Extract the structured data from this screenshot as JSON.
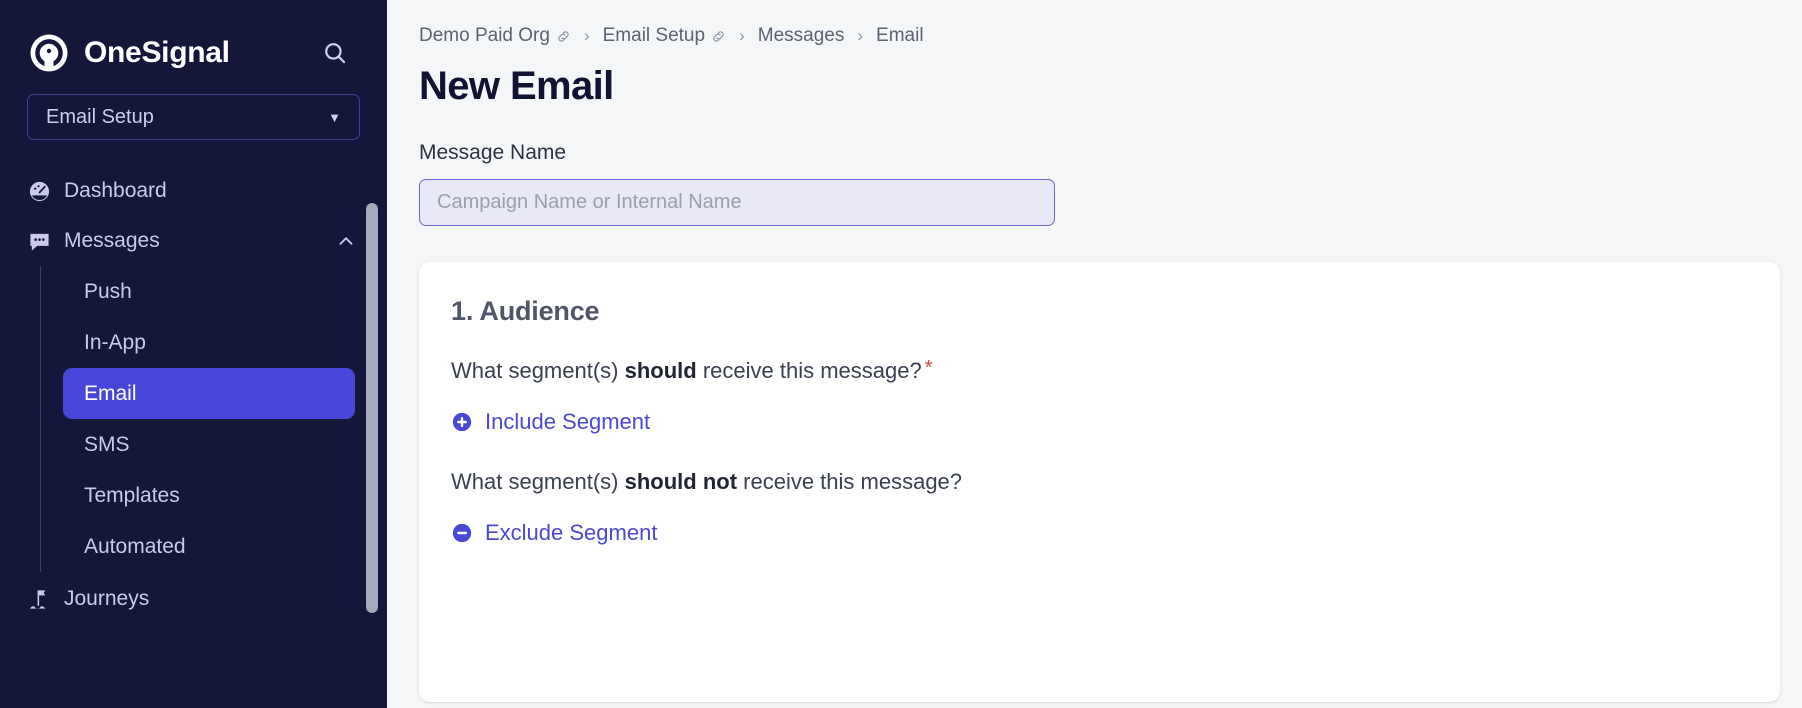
{
  "sidebar": {
    "brand": {
      "name": "OneSignal",
      "logo_icon": "onesignal-logo-icon",
      "search_icon": "search-icon"
    },
    "app_selector": {
      "label": "Email Setup",
      "caret_icon": "caret-down-icon"
    },
    "nav": [
      {
        "label": "Dashboard",
        "icon": "speedometer-icon",
        "active": false
      },
      {
        "label": "Messages",
        "icon": "chat-bubble-icon",
        "active": false,
        "expanded": true,
        "chevron_icon": "chevron-up-icon"
      }
    ],
    "messages_children": [
      {
        "label": "Push",
        "active": false
      },
      {
        "label": "In-App",
        "active": false
      },
      {
        "label": "Email",
        "active": true
      },
      {
        "label": "SMS",
        "active": false
      },
      {
        "label": "Templates",
        "active": false
      },
      {
        "label": "Automated",
        "active": false
      }
    ],
    "nav_bottom": [
      {
        "label": "Journeys",
        "icon": "journey-flag-icon",
        "active": false
      }
    ],
    "scrollbar": "sidebar-scrollbar"
  },
  "breadcrumb": [
    {
      "label": "Demo Paid Org",
      "has_link_icon": true
    },
    {
      "label": "Email Setup",
      "has_link_icon": true
    },
    {
      "label": "Messages",
      "has_link_icon": false
    },
    {
      "label": "Email",
      "has_link_icon": false
    }
  ],
  "breadcrumb_separator": "›",
  "page": {
    "title": "New Email",
    "message_name_label": "Message Name",
    "message_name_value": "",
    "message_name_placeholder": "Campaign Name or Internal Name"
  },
  "audience": {
    "card_title": "1. Audience",
    "include_question_prefix": "What segment(s) ",
    "include_question_bold": "should",
    "include_question_suffix": " receive this message?",
    "required_marker": "*",
    "include_button": {
      "label": "Include Segment",
      "icon": "plus-circle-icon"
    },
    "exclude_question_prefix": "What segment(s) ",
    "exclude_question_bold": "should not",
    "exclude_question_suffix": " receive this message?",
    "exclude_button": {
      "label": "Exclude Segment",
      "icon": "minus-circle-icon"
    }
  },
  "colors": {
    "sidebar_bg": "#15173a",
    "accent_indigo": "#4746d8",
    "link_indigo": "#4a49d6",
    "page_bg": "#f5f6f8",
    "card_bg": "#ffffff",
    "required_red": "#d0453d",
    "input_bg": "#e9e8f6",
    "input_border": "#6a67d4"
  }
}
